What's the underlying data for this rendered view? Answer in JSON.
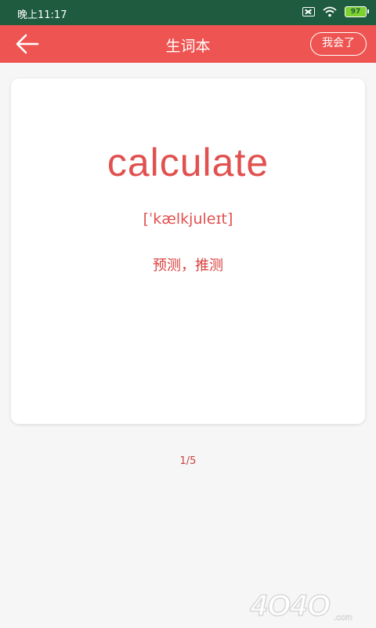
{
  "status_bar": {
    "time": "晚上11:17",
    "battery": "97"
  },
  "app_bar": {
    "title": "生词本",
    "known_button": "我会了"
  },
  "card": {
    "word": "calculate",
    "phonetic": "[ˈkælkjuleɪt]",
    "meaning": "预测，推测"
  },
  "pager": {
    "indicator": "1/5"
  },
  "colors": {
    "status_bar_bg": "#1f5b3f",
    "app_bar_bg": "#ee5552",
    "accent_text": "#e0514f"
  },
  "icons": {
    "back": "arrow-left-icon",
    "wifi": "wifi-icon",
    "sim": "sim-off-icon",
    "battery": "battery-icon"
  },
  "watermark": {
    "text": "4O4O.com"
  }
}
